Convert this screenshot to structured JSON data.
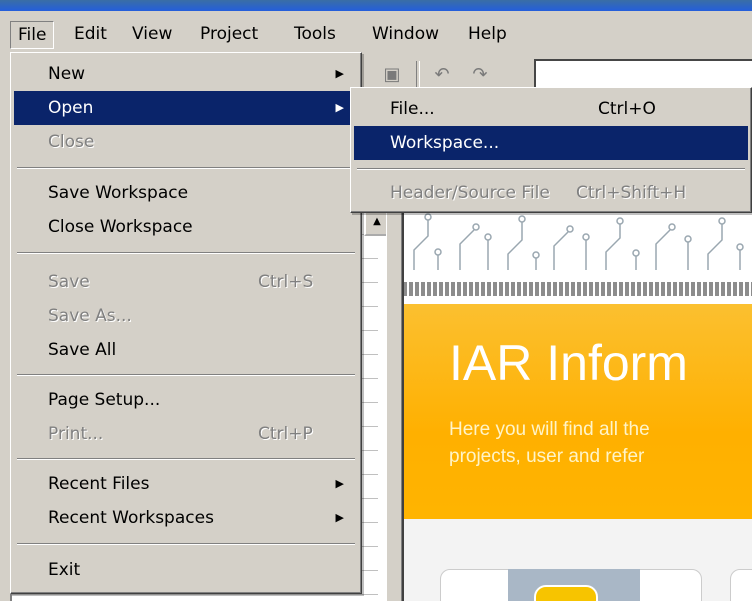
{
  "menubar": {
    "items": [
      "File",
      "Edit",
      "View",
      "Project",
      "Tools",
      "Window",
      "Help"
    ]
  },
  "file_menu": {
    "new": "New",
    "open": "Open",
    "close": "Close",
    "save_workspace": "Save Workspace",
    "close_workspace": "Close Workspace",
    "save": "Save",
    "save_shortcut": "Ctrl+S",
    "save_as": "Save As...",
    "save_all": "Save All",
    "page_setup": "Page Setup...",
    "print": "Print...",
    "print_shortcut": "Ctrl+P",
    "recent_files": "Recent Files",
    "recent_workspaces": "Recent Workspaces",
    "exit": "Exit"
  },
  "open_submenu": {
    "file": "File...",
    "file_shortcut": "Ctrl+O",
    "workspace": "Workspace...",
    "header_source": "Header/Source File",
    "header_source_shortcut": "Ctrl+Shift+H"
  },
  "info_center": {
    "heading": "IAR Inform",
    "subtitle_line1": "Here you will find all the",
    "subtitle_line2": "projects, user and refer"
  },
  "colors": {
    "menu_bg": "#d4d0c8",
    "highlight": "#0a246a",
    "banner": "#ffb000"
  }
}
